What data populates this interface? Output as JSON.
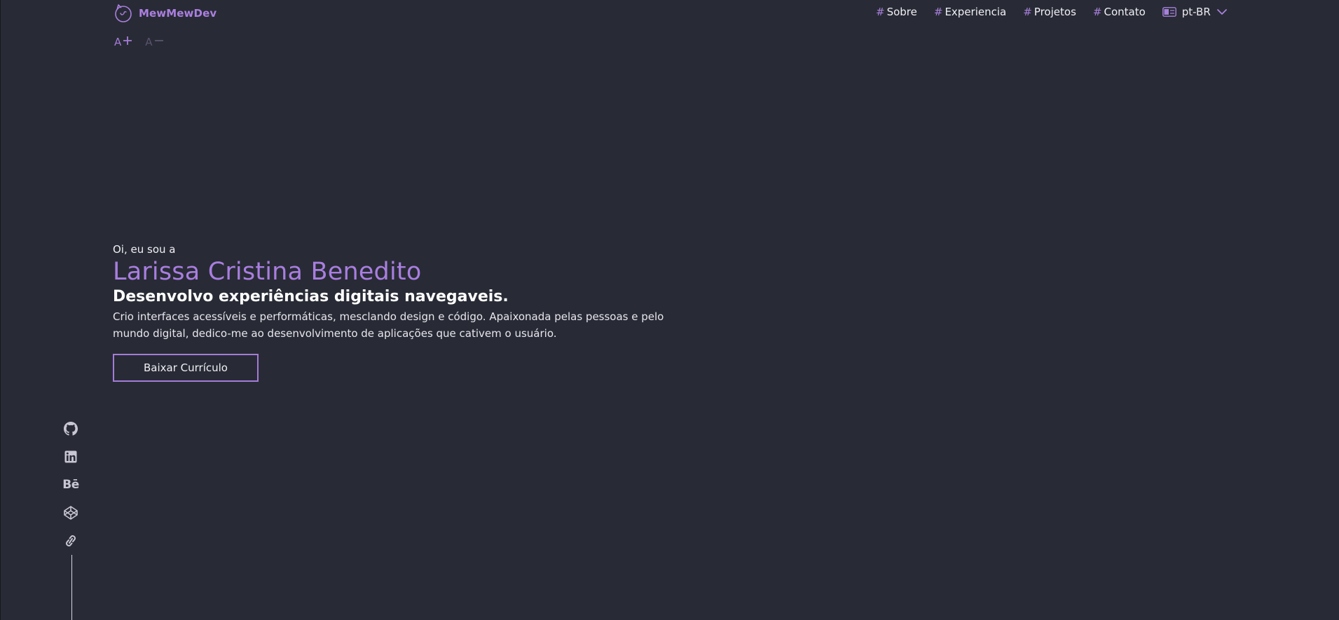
{
  "header": {
    "brand": "MewMewDev",
    "nav": [
      {
        "label": "Sobre"
      },
      {
        "label": "Experiencia"
      },
      {
        "label": "Projetos"
      },
      {
        "label": "Contato"
      }
    ],
    "nav_prefix": "#",
    "language": "pt-BR"
  },
  "font_controls": {
    "increase": "A",
    "decrease": "A"
  },
  "hero": {
    "greeting": "Oi, eu sou a",
    "name": "Larissa Cristina Benedito",
    "headline": "Desenvolvo experiências digitais navegaveis.",
    "description": "Crio interfaces acessíveis e performáticas, mesclando design e código. Apaixonada pelas pessoas e pelo mundo digital, dedico-me ao desenvolvimento de aplicações que cativem o usuário.",
    "cta": "Baixar Currículo"
  },
  "social": {
    "behance_glyph": "Bē",
    "icons": [
      "github-icon",
      "linkedin-icon",
      "behance-icon",
      "codepen-icon",
      "link-icon"
    ]
  },
  "colors": {
    "background": "#282b35",
    "accent": "#a97ee0",
    "text": "#f1eff6"
  }
}
